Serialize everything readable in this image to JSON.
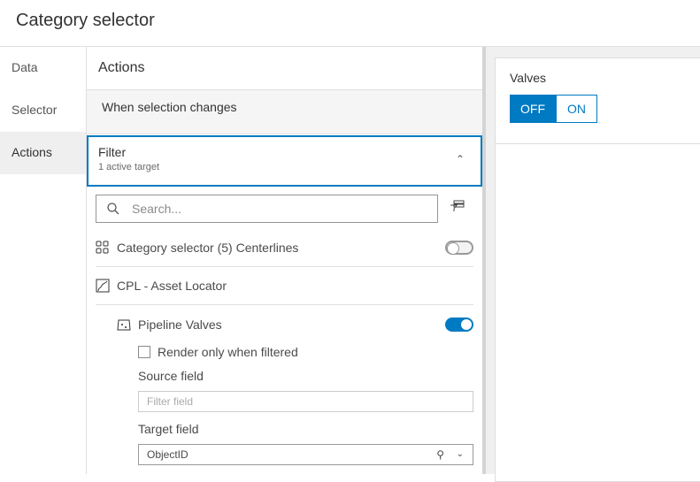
{
  "header": {
    "title": "Category selector"
  },
  "nav": {
    "items": [
      {
        "label": "Data"
      },
      {
        "label": "Selector"
      },
      {
        "label": "Actions"
      }
    ]
  },
  "panel": {
    "title": "Actions",
    "trigger": "When selection changes",
    "filter": {
      "title": "Filter",
      "subtitle": "1 active target"
    },
    "search": {
      "placeholder": "Search..."
    },
    "targets": [
      {
        "label": "Category selector (5) Centerlines",
        "enabled": false
      },
      {
        "label": "CPL - Asset Locator"
      }
    ],
    "layer": {
      "label": "Pipeline Valves",
      "enabled": true,
      "render_only_label": "Render only when filtered",
      "render_only_checked": false,
      "source_label": "Source field",
      "source_placeholder": "Filter field",
      "target_label": "Target field",
      "target_value": "ObjectID"
    }
  },
  "preview": {
    "title": "Valves",
    "off_label": "OFF",
    "on_label": "ON",
    "selected": "OFF"
  },
  "colors": {
    "accent": "#007ac2"
  }
}
